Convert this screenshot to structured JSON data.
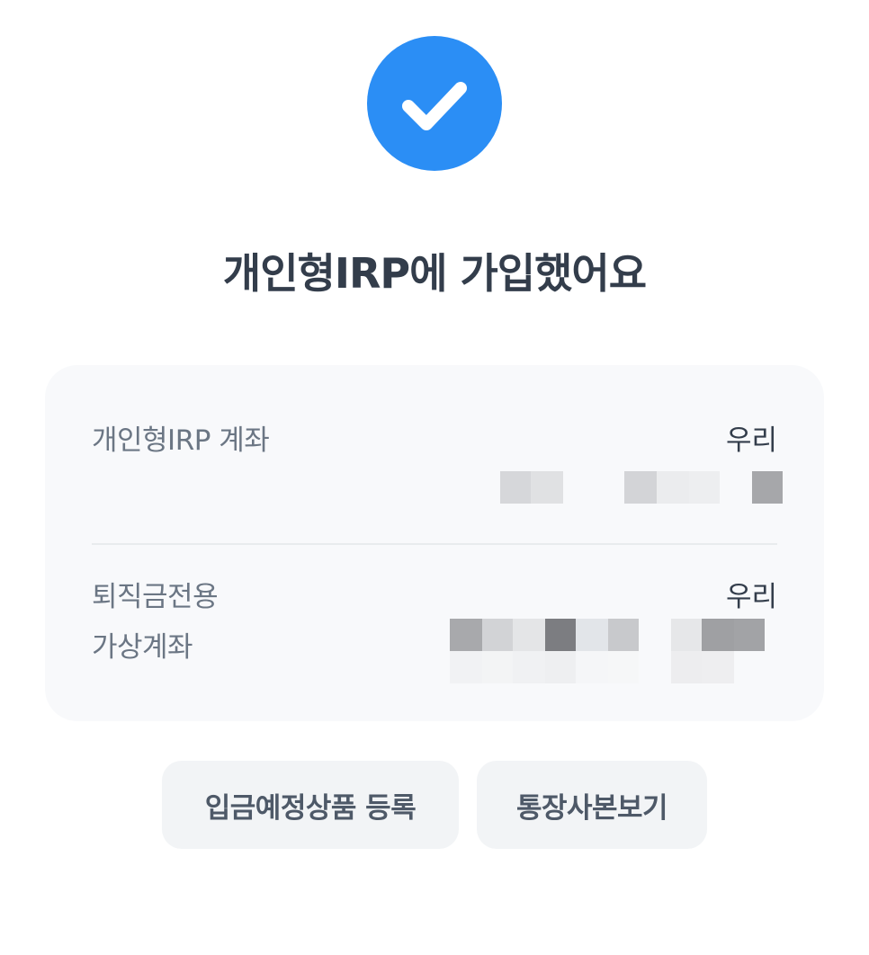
{
  "colors": {
    "accent": "#2b8ef5",
    "title_text": "#333d4b",
    "label_text": "#6b7684",
    "card_bg": "#f8f9fb",
    "button_bg": "#f2f4f6"
  },
  "icon": "check-circle-icon",
  "title": "개인형IRP에 가입했어요",
  "card": {
    "irp_account": {
      "label": "개인형IRP 계좌",
      "bank": "우리"
    },
    "retirement_virtual_account": {
      "label_line1": "퇴직금전용",
      "label_line2": "가상계좌",
      "bank": "우리"
    }
  },
  "buttons": {
    "register_deposit_product": "입금예정상품 등록",
    "view_passbook_copy": "통장사본보기"
  }
}
